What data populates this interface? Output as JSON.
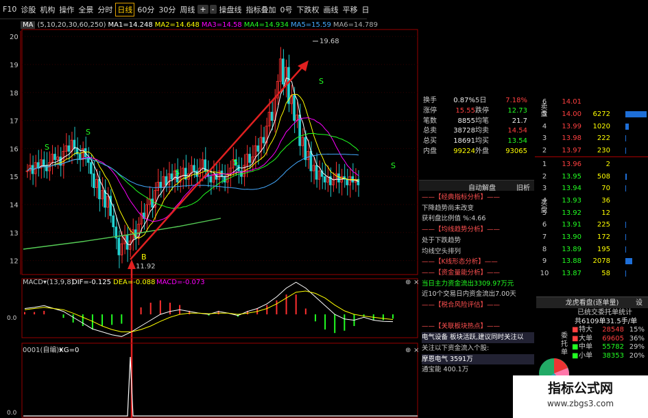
{
  "toolbar": {
    "items": [
      "F10",
      "诊股",
      "机构",
      "操作",
      "全景",
      "分时",
      "日线",
      "60分",
      "30分",
      "周线",
      "+",
      "-",
      "操盘线",
      "指标叠加",
      "0号",
      "下跌权",
      "画线",
      "平移",
      "日"
    ],
    "selected": "日线"
  },
  "ma_bar": {
    "label": "MA",
    "params": "(5,10,20,30,60,250)",
    "ma1": "MA1=14.248",
    "ma2": "MA2=14.648",
    "ma3": "MA3=14.58",
    "ma4": "MA4=14.934",
    "ma5": "MA5=15.59",
    "ma6": "MA6=14.789"
  },
  "price_axis": [
    "20",
    "19",
    "18",
    "17",
    "16",
    "15",
    "14",
    "13",
    "12"
  ],
  "price_labels": {
    "high": "19.68",
    "low": "11.92",
    "b_marker": "B"
  },
  "macd_bar": {
    "label": "MACD",
    "params": "(13,9,8)",
    "dif": "DIF=-0.125",
    "dea": "DEA=-0.088",
    "macd": "MACD=-0.073",
    "zero": "0.0"
  },
  "xg_bar": {
    "label": "0001(自编)",
    "xg": "XG=0",
    "zero": "0.0"
  },
  "stats": [
    [
      "换手",
      "0.87%",
      "5日",
      "7.18%"
    ],
    [
      "涨停",
      "15.55",
      "跌停",
      "12.73"
    ],
    [
      "笔数",
      "8855",
      "均笔",
      "21.7"
    ],
    [
      "总卖",
      "38728",
      "均卖",
      "14.54"
    ],
    [
      "总买",
      "18691",
      "均买",
      "13.54"
    ],
    [
      "内盘",
      "99224",
      "外盘",
      "93065"
    ]
  ],
  "analysis_header": {
    "title": "自动解盘",
    "right": "旧析"
  },
  "analysis_lines": [
    {
      "t": "——【经典指标分析】——",
      "c": "h"
    },
    {
      "t": "下降趋势尚未改变",
      "c": ""
    },
    {
      "t": "获利盘比例值 %:4.66",
      "c": ""
    },
    {
      "t": "——【均线趋势分析】——",
      "c": "h"
    },
    {
      "t": "处于下跌趋势",
      "c": ""
    },
    {
      "t": "均线空头排列",
      "c": ""
    },
    {
      "t": "——【K线形态分析】——",
      "c": "h"
    },
    {
      "t": "——【资金量能分析】——",
      "c": "h"
    },
    {
      "t": "当日主力资金流出3309.97万元",
      "c": "c"
    },
    {
      "t": "近10个交易日内资金流出7.00天",
      "c": ""
    },
    {
      "t": "——【税合风险评估】——",
      "c": "h"
    },
    {
      "t": "",
      "c": ""
    },
    {
      "t": "——【关联板块热点】——",
      "c": "h"
    },
    {
      "t": "电气设备 板块活跃,建议同时关注以",
      "c": "w"
    },
    {
      "t": "关注以下资金流入个股:",
      "c": ""
    },
    {
      "t": "摩恩电气 3591万",
      "c": "w"
    },
    {
      "t": "通宝能 400.1万",
      "c": ""
    }
  ],
  "orderbook": {
    "sell_label": "卖盘",
    "buy_label": "买盘",
    "rows": [
      {
        "n": "6",
        "p": "14.01",
        "v": "",
        "bar": 0
      },
      {
        "n": "5",
        "p": "14.00",
        "v": "6272",
        "bar": 0.95
      },
      {
        "n": "4",
        "p": "13.99",
        "v": "1020",
        "bar": 0.15
      },
      {
        "n": "3",
        "p": "13.98",
        "v": "222",
        "bar": 0.03
      },
      {
        "n": "2",
        "p": "13.97",
        "v": "230",
        "bar": 0.03
      },
      {
        "n": "1",
        "p": "13.96",
        "v": "2",
        "bar": 0
      },
      {
        "n": "2",
        "p": "13.95",
        "v": "508",
        "bar": 0.07
      },
      {
        "n": "3",
        "p": "13.94",
        "v": "70",
        "bar": 0.01
      },
      {
        "n": "4",
        "p": "13.93",
        "v": "36",
        "bar": 0
      },
      {
        "n": "5",
        "p": "13.92",
        "v": "12",
        "bar": 0
      },
      {
        "n": "6",
        "p": "13.91",
        "v": "225",
        "bar": 0.03
      },
      {
        "n": "7",
        "p": "13.90",
        "v": "172",
        "bar": 0.02
      },
      {
        "n": "8",
        "p": "13.89",
        "v": "195",
        "bar": 0.03
      },
      {
        "n": "9",
        "p": "13.88",
        "v": "2078",
        "bar": 0.3
      },
      {
        "n": "10",
        "p": "13.87",
        "v": "58",
        "bar": 0.01
      }
    ]
  },
  "dragon": {
    "title": "龙虎看盘(逐单量)",
    "right": "设",
    "subtitle": "已统交委托单统计",
    "total": "共6109单31.5手/单",
    "side_label": "委托单",
    "rows": [
      {
        "name": "特大",
        "v": "28548",
        "pct": "15%"
      },
      {
        "name": "大单",
        "v": "69605",
        "pct": "36%"
      },
      {
        "name": "中单",
        "v": "55782",
        "pct": "29%"
      },
      {
        "name": "小单",
        "v": "38353",
        "pct": "20%"
      }
    ]
  },
  "watermark": {
    "title": "指标公式网",
    "url": "www.zbgs3.com"
  },
  "chart_data": {
    "type": "candlestick",
    "ylim": [
      11.5,
      20.2
    ],
    "yticks": [
      12,
      13,
      14,
      15,
      16,
      17,
      18,
      19,
      20
    ],
    "close": [
      15.2,
      15.4,
      15.1,
      15.5,
      15.3,
      15.6,
      15.4,
      15.2,
      15.5,
      15.8,
      15.6,
      15.7,
      15.4,
      15.9,
      16.1,
      15.9,
      16.3,
      16.0,
      15.8,
      15.6,
      16.0,
      15.7,
      15.5,
      15.1,
      14.6,
      14.9,
      14.2,
      14.5,
      13.9,
      14.3,
      13.6,
      13.2,
      12.8,
      12.2,
      12.6,
      12.9,
      12.4,
      12.7,
      13.1,
      12.8,
      13.3,
      13.7,
      13.5,
      14.0,
      14.2,
      13.9,
      14.5,
      14.8,
      14.6,
      15.0,
      14.7,
      15.1,
      14.9,
      15.2,
      14.8,
      15.0,
      15.3,
      14.9,
      15.1,
      15.4,
      15.2,
      15.0,
      15.3,
      15.6,
      15.2,
      15.0,
      14.8,
      15.1,
      14.9,
      15.2,
      15.0,
      14.8,
      15.1,
      15.3,
      15.6,
      15.4,
      15.2,
      15.0,
      15.4,
      15.8,
      15.5,
      15.7,
      16.1,
      15.9,
      16.4,
      16.2,
      16.8,
      17.3,
      17.0,
      17.8,
      18.4,
      19.2,
      18.3,
      18.9,
      17.6,
      17.9,
      17.0,
      17.2,
      16.1,
      16.4,
      15.6,
      15.9,
      15.2,
      15.4,
      14.9,
      15.2,
      15.0,
      14.8,
      15.0,
      14.7,
      14.9,
      15.1,
      14.8,
      15.0,
      14.9,
      14.7,
      15.0,
      14.8,
      14.9,
      14.7
    ],
    "high_label": 19.68,
    "low_label": 11.92,
    "macd_dif": [
      0.1,
      0.12,
      0.15,
      0.1,
      0.05,
      -0.05,
      -0.15,
      -0.25,
      -0.3,
      -0.35,
      -0.38,
      -0.3,
      -0.2,
      -0.1,
      0.0,
      0.05,
      0.08,
      0.05,
      0.02,
      0.0,
      0.05,
      0.02,
      -0.02,
      0.05,
      0.1,
      0.18,
      0.3,
      0.45,
      0.55,
      0.45,
      0.3,
      0.15,
      0.0,
      -0.08,
      -0.1,
      -0.05,
      -0.1,
      -0.12,
      -0.125
    ],
    "macd_dea": [
      0.08,
      0.1,
      0.12,
      0.1,
      0.08,
      0.02,
      -0.05,
      -0.12,
      -0.2,
      -0.26,
      -0.3,
      -0.3,
      -0.26,
      -0.2,
      -0.12,
      -0.05,
      0.0,
      0.02,
      0.02,
      0.01,
      0.02,
      0.02,
      0.0,
      0.02,
      0.05,
      0.1,
      0.18,
      0.28,
      0.38,
      0.4,
      0.36,
      0.28,
      0.16,
      0.06,
      0.0,
      -0.03,
      -0.05,
      -0.07,
      -0.088
    ]
  }
}
